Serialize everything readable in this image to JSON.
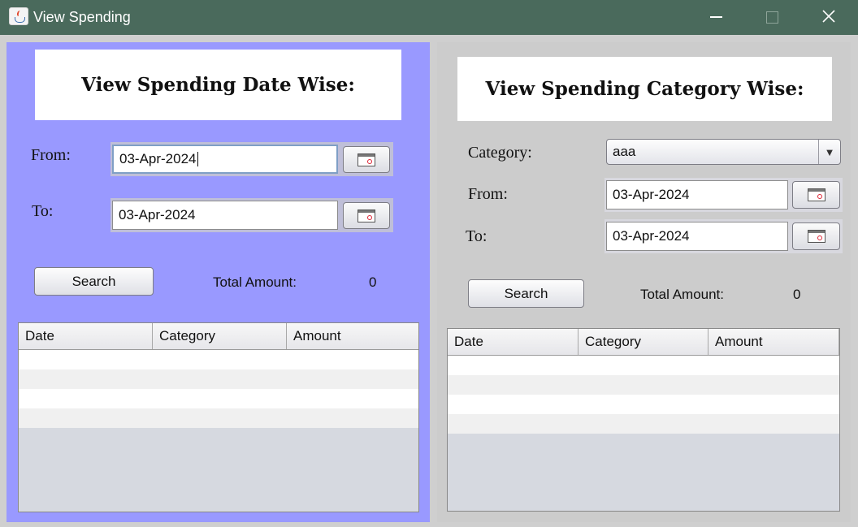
{
  "window": {
    "title": "View Spending",
    "controls": {
      "minimize": "minimize-icon",
      "maximize": "maximize-icon",
      "close": "close-icon"
    }
  },
  "date_wise": {
    "heading": "View Spending Date Wise:",
    "from_label": "From:",
    "from_value": "03-Apr-2024",
    "to_label": "To:",
    "to_value": "03-Apr-2024",
    "search_label": "Search",
    "total_label": "Total Amount:",
    "total_value": "0",
    "columns": [
      "Date",
      "Category",
      "Amount"
    ],
    "panel_color": "#9999ff"
  },
  "category_wise": {
    "heading": "View Spending Category Wise:",
    "category_label": "Category:",
    "category_value": "aaa",
    "from_label": "From:",
    "from_value": "03-Apr-2024",
    "to_label": "To:",
    "to_value": "03-Apr-2024",
    "search_label": "Search",
    "total_label": "Total Amount:",
    "total_value": "0",
    "columns": [
      "Date",
      "Category",
      "Amount"
    ],
    "panel_color": "#cccccc"
  },
  "icons": {
    "calendar": "calendar-icon",
    "dropdown": "chevron-down-icon",
    "app": "java-app-icon"
  }
}
